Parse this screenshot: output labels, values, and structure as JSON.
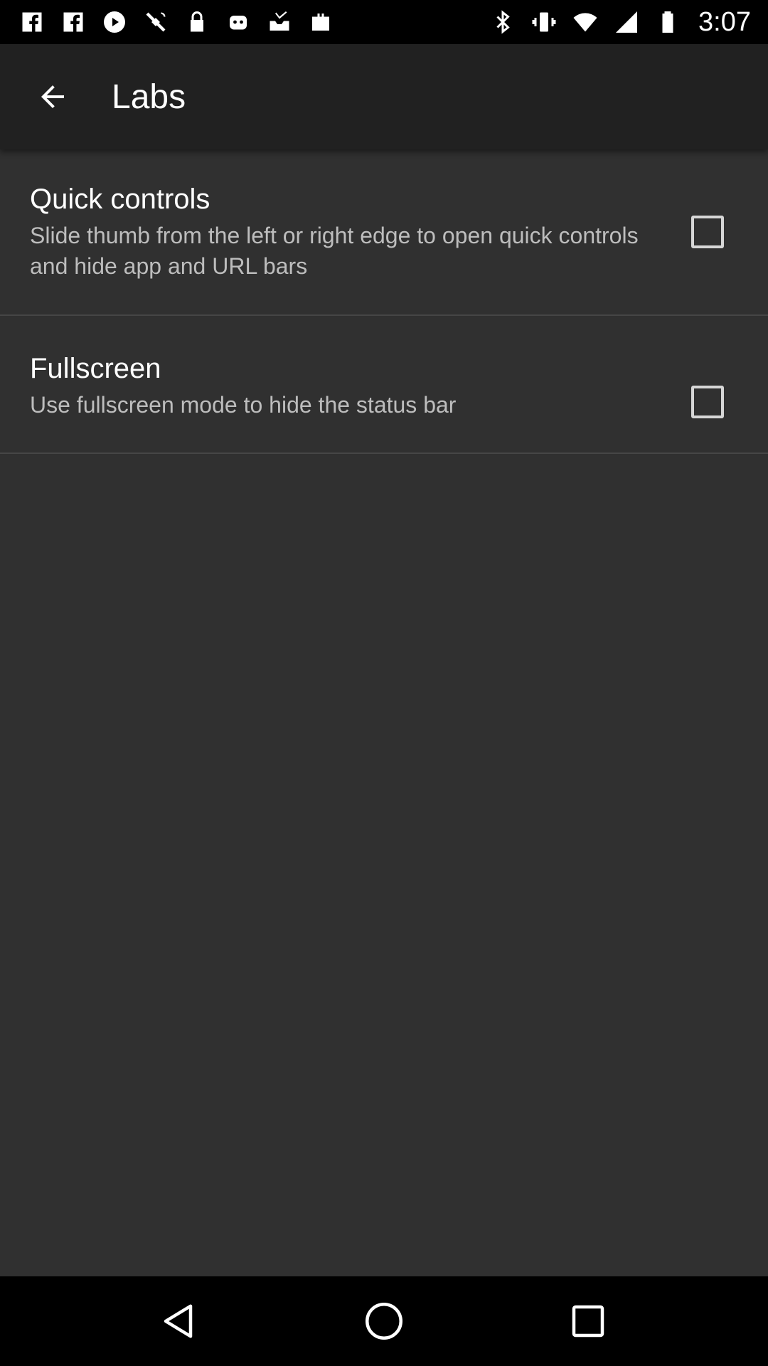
{
  "status_bar": {
    "time": "3:07",
    "left_icons": [
      "facebook-icon",
      "facebook-icon",
      "play-icon",
      "satellite-icon",
      "lock-icon",
      "robot-icon",
      "inbox-icon",
      "briefcase-icon"
    ],
    "right_icons": [
      "bluetooth-icon",
      "vibrate-icon",
      "wifi-icon",
      "signal-icon",
      "battery-icon"
    ]
  },
  "app_bar": {
    "title": "Labs",
    "back_icon": "arrow-back-icon"
  },
  "preferences": [
    {
      "title": "Quick controls",
      "summary": "Slide thumb from the left or right edge to open quick controls and hide app and URL bars",
      "checked": false
    },
    {
      "title": "Fullscreen",
      "summary": "Use fullscreen mode to hide the status bar",
      "checked": false
    }
  ],
  "nav_bar": {
    "icons": [
      "back-triangle-icon",
      "home-circle-icon",
      "recents-square-icon"
    ]
  },
  "colors": {
    "background": "#303030",
    "app_bar": "#212121",
    "status_bar": "#000000",
    "summary_text": "#bdbdbd"
  }
}
